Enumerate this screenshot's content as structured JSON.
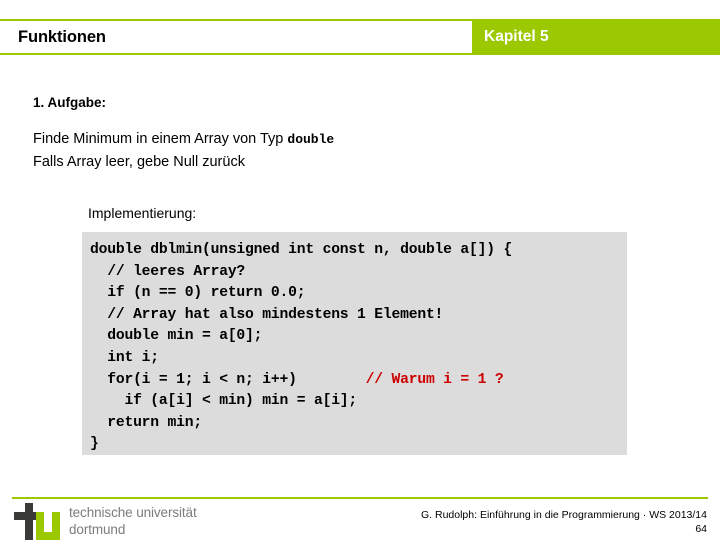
{
  "header": {
    "title": "Funktionen",
    "chapter": "Kapitel 5",
    "accent_color": "#9BC800"
  },
  "slide": {
    "task_heading": "1. Aufgabe:",
    "description_line1_prefix": "Finde Minimum in einem Array von Typ ",
    "description_line1_mono": "double",
    "description_line2": "Falls Array leer, gebe Null zurück",
    "implementation_label": "Implementierung:"
  },
  "code": {
    "background_color": "#DCDCDC",
    "comment_color": "#CC0000",
    "lines": [
      {
        "text": "double dblmin(unsigned int const n, double a[]) {"
      },
      {
        "text": "  // leeres Array?"
      },
      {
        "text": "  if (n == 0) return 0.0;"
      },
      {
        "text": "  // Array hat also mindestens 1 Element!"
      },
      {
        "text": "  double min = a[0];"
      },
      {
        "text": "  int i;"
      },
      {
        "text": "  for(i = 1; i < n; i++)",
        "comment": "        // Warum i = 1 ?"
      },
      {
        "text": "    if (a[i] < min) min = a[i];"
      },
      {
        "text": "  return min;"
      },
      {
        "text": "}"
      }
    ]
  },
  "footer": {
    "logo_line1": "technische universität",
    "logo_line2": "dortmund",
    "citation": "G. Rudolph: Einführung in die Programmierung · WS 2013/14",
    "page_number": "64"
  }
}
